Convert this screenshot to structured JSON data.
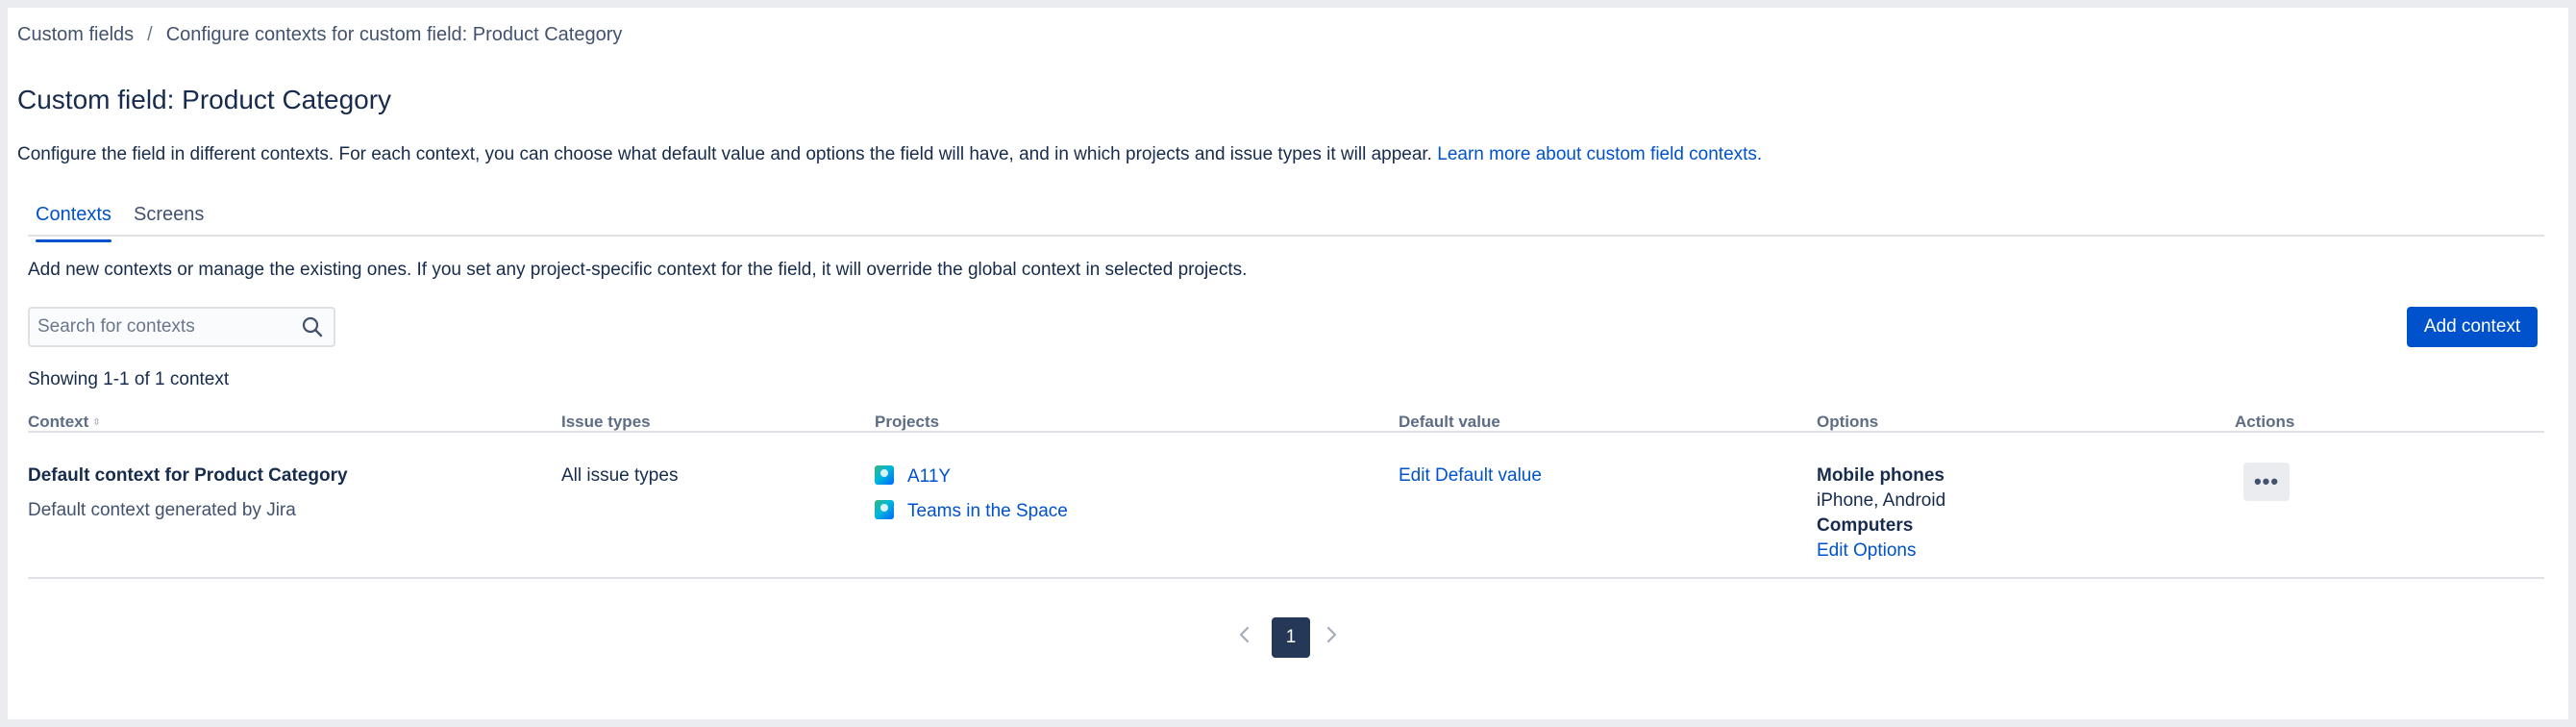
{
  "breadcrumb": {
    "items": [
      "Custom fields",
      "Configure contexts for custom field: Product Category"
    ],
    "separator": "/"
  },
  "page_title": "Custom field: Product Category",
  "description": {
    "text": "Configure the field in different contexts. For each context, you can choose what default value and options the field will have, and in which projects and issue types it will appear.",
    "link": "Learn more about custom field contexts."
  },
  "tabs": [
    {
      "label": "Contexts",
      "active": true
    },
    {
      "label": "Screens",
      "active": false
    }
  ],
  "subdescription": "Add new contexts or manage the existing ones. If you set any project-specific context for the field, it will override the global context in selected projects.",
  "search": {
    "placeholder": "Search for contexts",
    "value": ""
  },
  "add_button": "Add context",
  "showing": "Showing 1-1 of 1 context",
  "table": {
    "headers": [
      "Context",
      "Issue types",
      "Projects",
      "Default value",
      "Options",
      "Actions"
    ],
    "rows": [
      {
        "context_name": "Default context for Product Category",
        "context_desc": "Default context generated by Jira",
        "issue_types": "All issue types",
        "projects": [
          "A11Y",
          "Teams in the Space"
        ],
        "default_value": "Edit Default value",
        "options": [
          {
            "name": "Mobile phones",
            "children": "iPhone, Android"
          },
          {
            "name": "Computers"
          }
        ],
        "edit_options": "Edit Options",
        "actions_label": "•••"
      }
    ]
  },
  "pagination": {
    "current": "1"
  },
  "colors": {
    "primary": "#0052cc",
    "text": "#172b4d",
    "muted": "#42526e",
    "border": "#dfe1e6",
    "page_active": "#253858"
  }
}
